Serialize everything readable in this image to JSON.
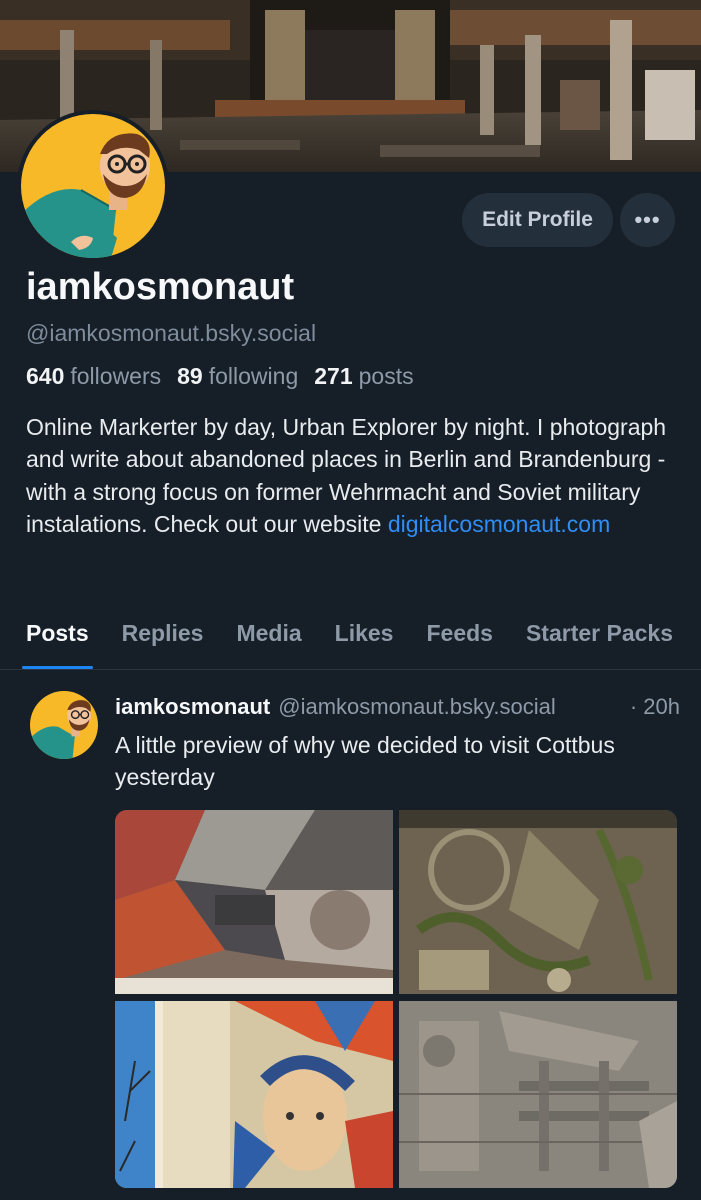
{
  "profile": {
    "display_name": "iamkosmonaut",
    "handle": "@iamkosmonaut.bsky.social",
    "stats": {
      "followers_count": "640",
      "followers_label": "followers",
      "following_count": "89",
      "following_label": "following",
      "posts_count": "271",
      "posts_label": "posts"
    },
    "bio_text": "Online Markerter by day, Urban Explorer by night. I photograph and write about abandoned places in Berlin and Brandenburg - with a strong focus on former Wehrmacht and Soviet military instalations. Check out our website ",
    "bio_link": "digitalcosmonaut.com"
  },
  "actions": {
    "edit_profile_label": "Edit Profile",
    "more_label": "•••"
  },
  "tabs": [
    {
      "label": "Posts",
      "active": true
    },
    {
      "label": "Replies",
      "active": false
    },
    {
      "label": "Media",
      "active": false
    },
    {
      "label": "Likes",
      "active": false
    },
    {
      "label": "Feeds",
      "active": false
    },
    {
      "label": "Starter Packs",
      "active": false
    }
  ],
  "post": {
    "author_name": "iamkosmonaut",
    "author_handle": "@iamkosmonaut.bsky.social",
    "time": "· 20h",
    "text": "A little preview of why we decided to visit Cottbus yesterday"
  },
  "colors": {
    "background": "#161e27",
    "accent": "#1d85f2",
    "link": "#2f8ef6",
    "avatar_bg": "#f7b928"
  }
}
